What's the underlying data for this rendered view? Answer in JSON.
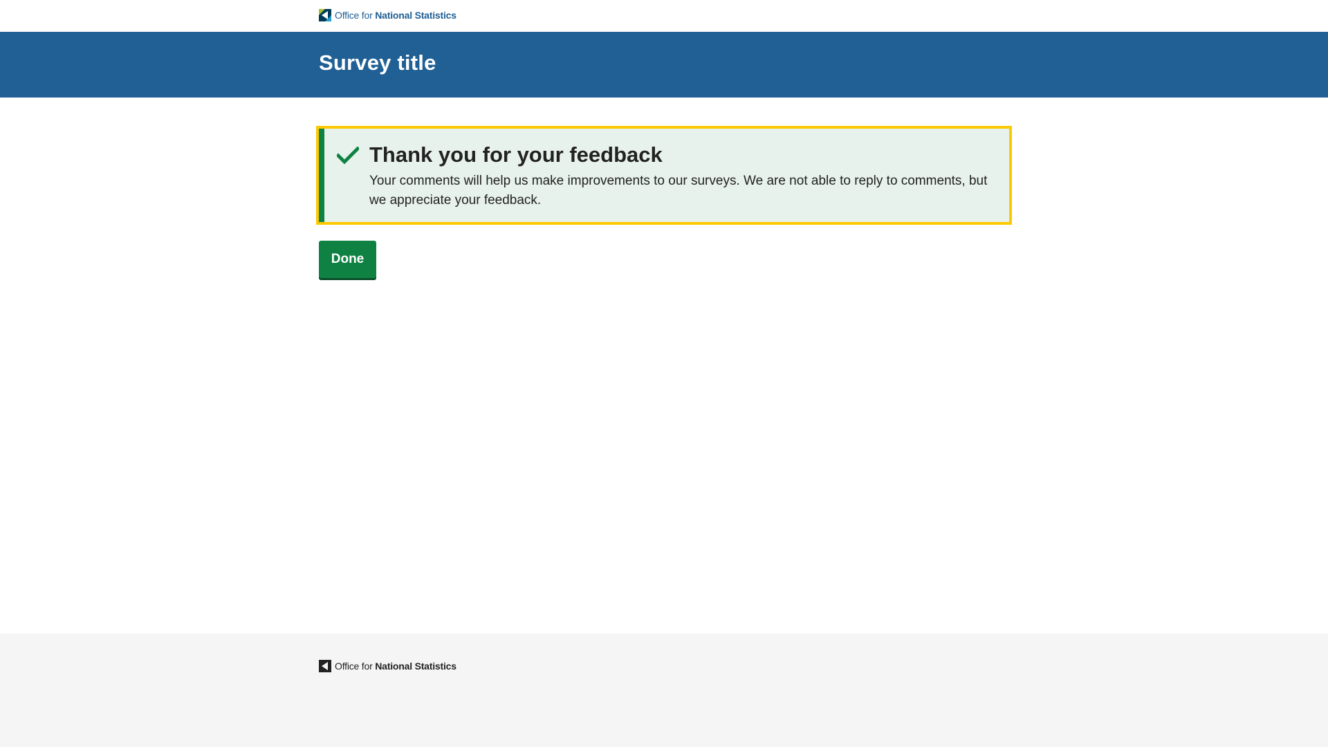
{
  "masthead": {
    "logo": {
      "text_light": "Office for",
      "text_bold": "National Statistics",
      "icon": "ons-logo-icon"
    }
  },
  "header": {
    "title": "Survey title"
  },
  "panel": {
    "icon": "check-icon",
    "title": "Thank you for your feedback",
    "body": "Your comments will help us make improvements to our surveys. We are not able to reply to comments, but we appreciate your feedback."
  },
  "actions": {
    "done_label": "Done"
  },
  "footer": {
    "logo": {
      "text_light": "Office for",
      "text_bold": "National Statistics",
      "icon": "ons-logo-icon"
    }
  },
  "colors": {
    "brand_blue": "#206095",
    "success_green": "#0f8243",
    "focus_yellow": "#fbc900",
    "panel_background": "#e8f2ec",
    "footer_background": "#f5f5f5"
  }
}
